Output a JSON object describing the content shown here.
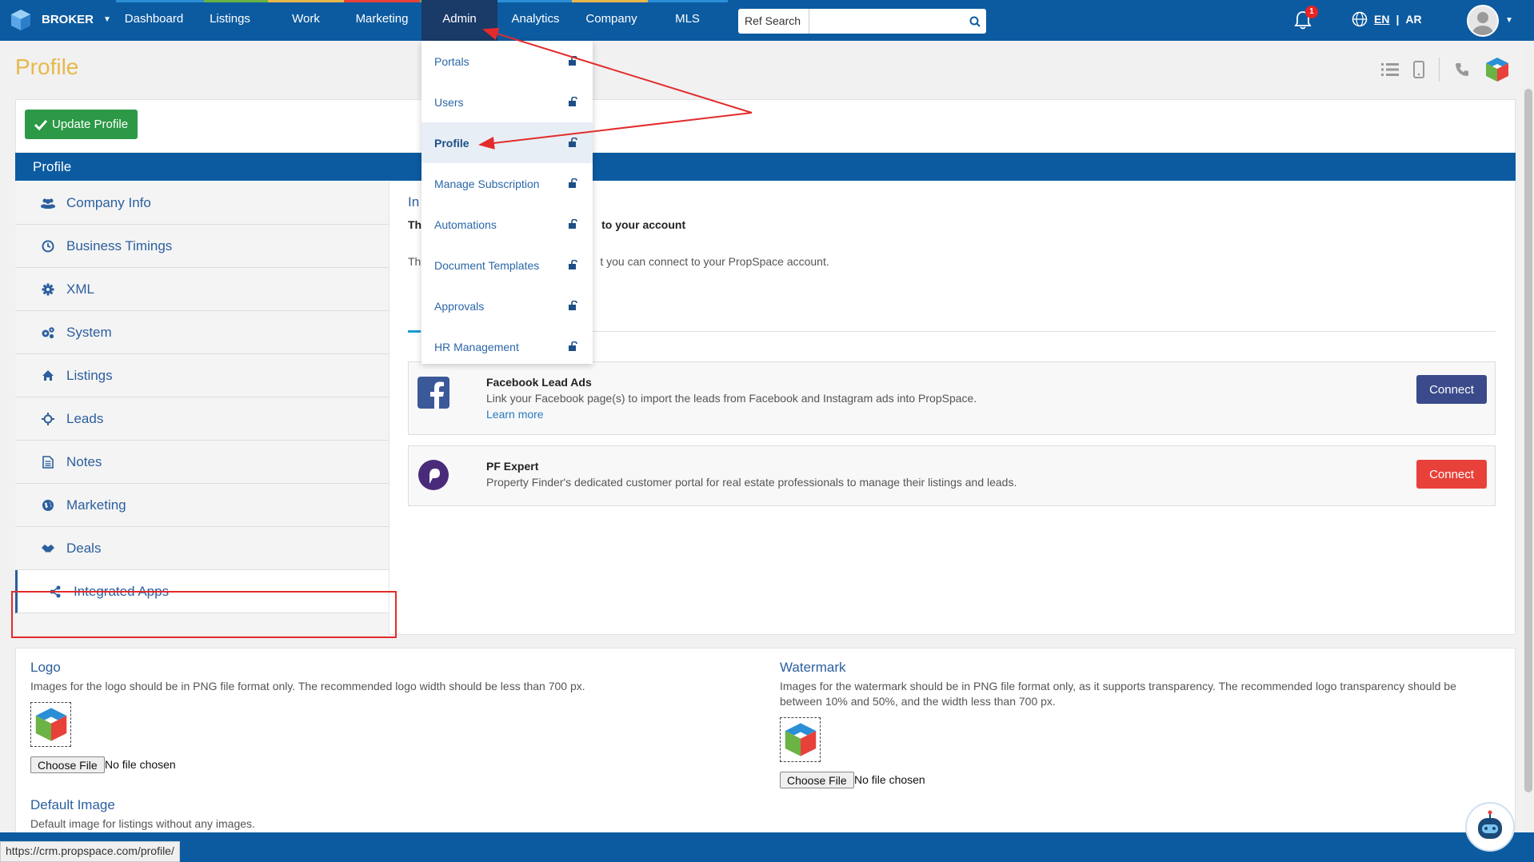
{
  "nav": {
    "brand": "BROKER",
    "items": [
      "Dashboard",
      "Listings",
      "Work",
      "Marketing",
      "Admin",
      "Analytics",
      "Company",
      "MLS"
    ],
    "active": "Admin",
    "search_dropdown": "Ref Search",
    "search_placeholder": "",
    "notification_count": "1",
    "lang_en": "EN",
    "lang_sep": "|",
    "lang_ar": "AR",
    "colors": {
      "primary": "#0c5ba0",
      "active": "#1a3a68"
    }
  },
  "page": {
    "title": "Profile",
    "update_button": "Update Profile",
    "section_title": "Profile"
  },
  "sidebar": {
    "items": [
      {
        "label": "Company Info",
        "icon": "users-icon"
      },
      {
        "label": "Business Timings",
        "icon": "clock-icon"
      },
      {
        "label": "XML",
        "icon": "gear-icon"
      },
      {
        "label": "System",
        "icon": "gears-icon"
      },
      {
        "label": "Listings",
        "icon": "home-icon"
      },
      {
        "label": "Leads",
        "icon": "crosshair-icon"
      },
      {
        "label": "Notes",
        "icon": "note-icon"
      },
      {
        "label": "Marketing",
        "icon": "globe-icon"
      },
      {
        "label": "Deals",
        "icon": "handshake-icon"
      },
      {
        "label": "Integrated Apps",
        "icon": "share-icon"
      }
    ],
    "active": "Integrated Apps"
  },
  "content": {
    "title": "In",
    "subtitle_start": "Th",
    "subtitle_end": "to your account",
    "desc_start": "Th",
    "desc_end": "t you can connect to your PropSpace account.",
    "apps": [
      {
        "name": "Facebook Lead Ads",
        "description": "Link your Facebook page(s) to import the leads from Facebook and Instagram ads into PropSpace.",
        "link": "Learn more",
        "button": "Connect",
        "button_color": "#3b4a8a"
      },
      {
        "name": "PF Expert",
        "description": "Property Finder's dedicated customer portal for real estate professionals to manage their listings and leads.",
        "link": "",
        "button": "Connect",
        "button_color": "#e8413a"
      }
    ]
  },
  "dropdown": {
    "items": [
      "Portals",
      "Users",
      "Profile",
      "Manage Subscription",
      "Automations",
      "Document Templates",
      "Approvals",
      "HR Management"
    ],
    "active": "Profile"
  },
  "lower": {
    "logo": {
      "title": "Logo",
      "description": "Images for the logo should be in PNG file format only. The recommended logo width should be less than 700 px.",
      "file_button": "Choose File",
      "file_text": "No file chosen"
    },
    "watermark": {
      "title": "Watermark",
      "description": "Images for the watermark should be in PNG file format only, as it supports transparency. The recommended logo transparency should be between 10% and 50%, and the width less than 700 px.",
      "file_button": "Choose File",
      "file_text": "No file chosen"
    },
    "default_image": {
      "title": "Default Image",
      "description": "Default image for listings without any images."
    }
  },
  "status_url": "https://crm.propspace.com/profile/"
}
